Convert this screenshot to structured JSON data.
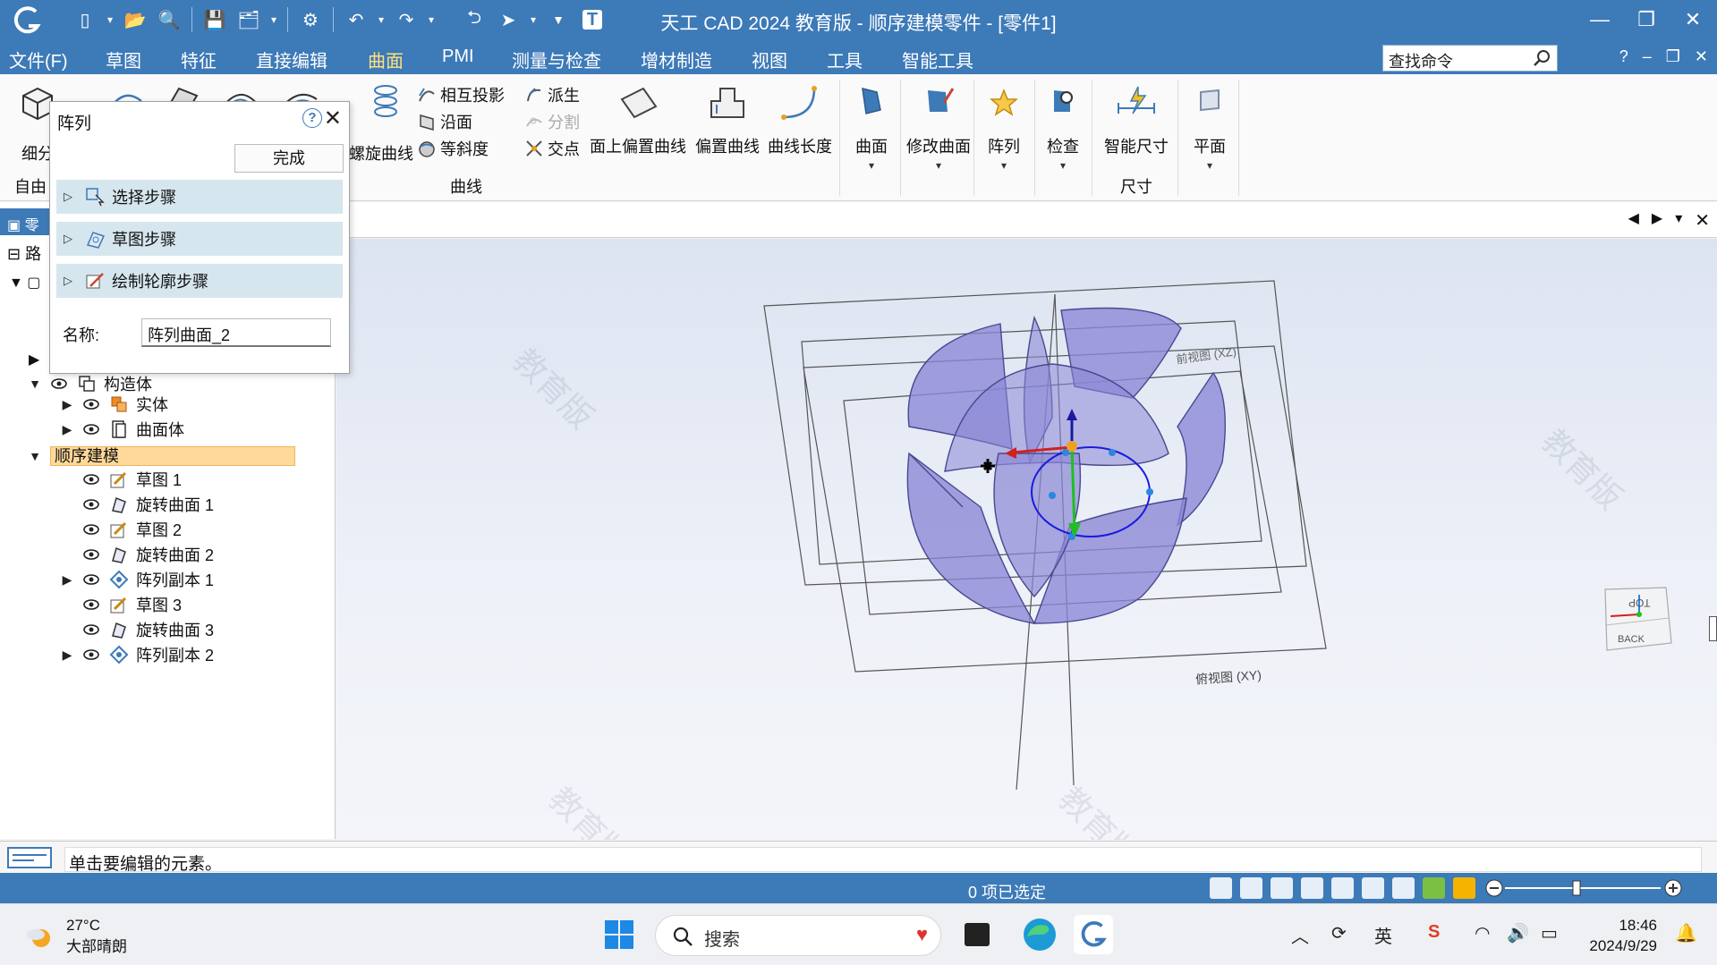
{
  "app": {
    "title": "天工 CAD 2024 教育版 - 顺序建模零件 - [零件1]"
  },
  "menu": {
    "items": [
      "文件(F)",
      "草图",
      "特征",
      "直接编辑",
      "曲面",
      "PMI",
      "测量与检查",
      "增材制造",
      "视图",
      "工具",
      "智能工具"
    ],
    "active": "曲面",
    "search_placeholder": "查找命令",
    "help": "?"
  },
  "ribbon": {
    "group_free": "自由",
    "btn_subdivide": "细分",
    "btn_helix": "螺旋曲线",
    "small_project": "相互投影",
    "small_along": "沿面",
    "small_isocline": "等斜度",
    "small_derive": "派生",
    "small_split": "分割",
    "small_intersect": "交点",
    "btn_offset_on_face": "面上偏置曲线",
    "btn_offset_curve": "偏置曲线",
    "btn_curve_length": "曲线长度",
    "group_curve": "曲线",
    "btn_surface": "曲面",
    "btn_modify_surface": "修改曲面",
    "btn_pattern": "阵列",
    "btn_inspect": "检查",
    "btn_smart_dim": "智能尺寸",
    "group_dim": "尺寸",
    "btn_plane": "平面"
  },
  "dialog": {
    "title": "阵列",
    "done": "完成",
    "steps": [
      "选择步骤",
      "草图步骤",
      "绘制轮廓步骤"
    ],
    "name_label": "名称:",
    "name_value": "阵列曲面_2"
  },
  "tree": {
    "tab_label_1": "零",
    "tab_label_2": "路",
    "items": [
      {
        "label": "构造体"
      },
      {
        "label": "实体"
      },
      {
        "label": "曲面体"
      },
      {
        "label": "顺序建模"
      },
      {
        "label": "草图 1"
      },
      {
        "label": "旋转曲面 1"
      },
      {
        "label": "草图 2"
      },
      {
        "label": "旋转曲面 2"
      },
      {
        "label": "阵列副本 1"
      },
      {
        "label": "草图 3"
      },
      {
        "label": "旋转曲面 3"
      },
      {
        "label": "阵列副本 2"
      }
    ]
  },
  "viewport": {
    "plane_label_front": "俯视图 (XY)",
    "plane_label_back": "前视图 (XZ)",
    "watermark": "教育版",
    "cube_top": "TOP",
    "cube_back": "BACK"
  },
  "prompt": {
    "text": "单击要编辑的元素。"
  },
  "status": {
    "selection": "0 项已选定"
  },
  "taskbar": {
    "temperature": "27°C",
    "weather": "大部晴朗",
    "search": "搜索",
    "ime": "英",
    "time": "18:46",
    "date": "2024/9/29"
  },
  "colors": {
    "accent": "#3d7ab8",
    "surface_fill": "#8a87d6",
    "highlight": "#ffd99a"
  }
}
